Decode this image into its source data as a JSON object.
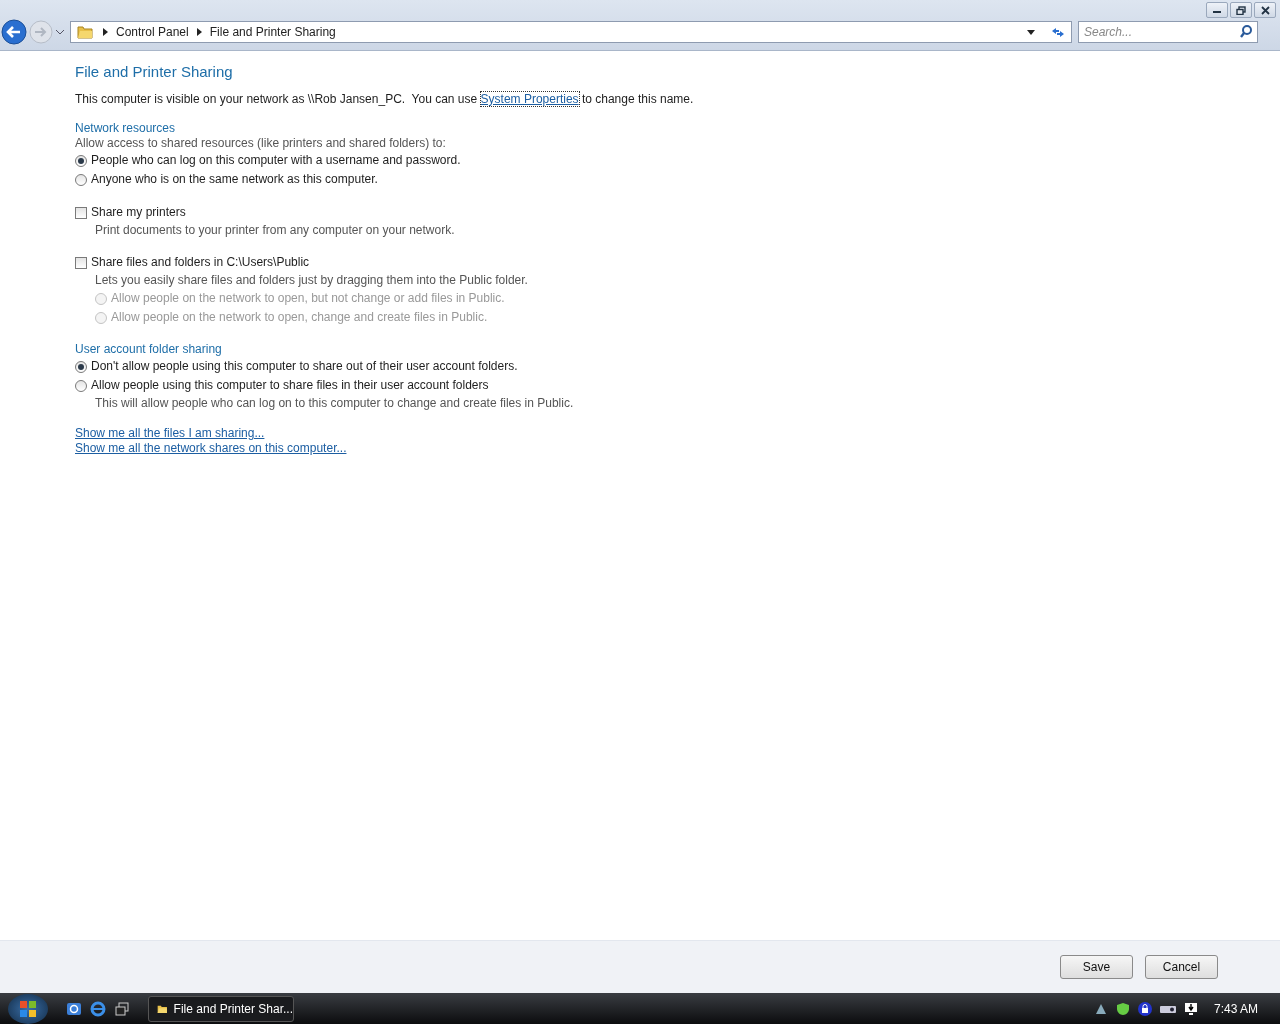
{
  "address_bar": {
    "crumbs": [
      "Control Panel",
      "File and Printer Sharing"
    ]
  },
  "search": {
    "placeholder": "Search..."
  },
  "page": {
    "title": "File and Printer Sharing",
    "intro": {
      "before": "This computer is visible on your network as \\\\Rob Jansen_PC.  You can use ",
      "link": "System Properties",
      "after": " to change this name."
    }
  },
  "sections": [
    {
      "heading": "Network resources",
      "items": [
        {
          "kind": "note",
          "text": "Allow access to shared resources (like printers and shared folders) to:"
        },
        {
          "kind": "radio",
          "text": "People who can log on this computer with a username and password.",
          "selected": true,
          "disabled": false
        },
        {
          "kind": "radio",
          "text": "Anyone who is on the same network as this computer.",
          "selected": false,
          "disabled": false
        }
      ]
    },
    {
      "items": [
        {
          "kind": "checkbox",
          "text": "Share my printers",
          "checked": false
        },
        {
          "kind": "detail",
          "text": "Print documents to your printer from any computer on your network."
        }
      ]
    },
    {
      "items": [
        {
          "kind": "checkbox",
          "text": "Share files and folders in C:\\Users\\Public",
          "checked": false
        },
        {
          "kind": "detail",
          "text": "Lets you easily share files and folders just by dragging them into the Public folder."
        },
        {
          "kind": "subradio",
          "text": "Allow people on the network to open, but not change or add files in Public.",
          "selected": false,
          "disabled": true
        },
        {
          "kind": "subradio",
          "text": "Allow people on the network to open, change and create files in Public.",
          "selected": false,
          "disabled": true
        }
      ]
    },
    {
      "heading": "User account folder sharing",
      "items": [
        {
          "kind": "radio",
          "text": "Don't allow people using this computer to share out of their user account folders.",
          "selected": true,
          "disabled": false
        },
        {
          "kind": "radio",
          "text": "Allow people using this computer to share files in their user account folders",
          "selected": false,
          "disabled": false
        },
        {
          "kind": "detail",
          "text": "This will allow people who can log on to this computer to change and create files in Public."
        }
      ]
    }
  ],
  "links": [
    "Show me all the files I am sharing...",
    "Show me all the network shares on this computer..."
  ],
  "buttons": [
    "Save",
    "Cancel"
  ],
  "taskbar": {
    "task": "File and Printer Shar...",
    "clock": "7:43 AM"
  }
}
